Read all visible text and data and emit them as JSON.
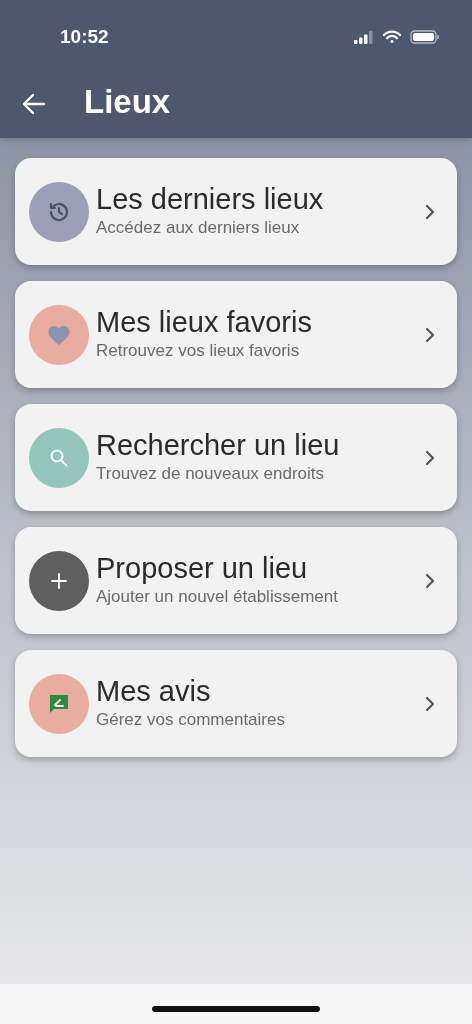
{
  "status_bar": {
    "time": "10:52"
  },
  "header": {
    "title": "Lieux"
  },
  "items": [
    {
      "kind": "history",
      "color": "#9ba0b8",
      "title": "Les derniers lieux",
      "subtitle": "Accédez aux derniers lieux"
    },
    {
      "kind": "heart",
      "color": "#e8aca0",
      "title": "Mes lieux favoris",
      "subtitle": "Retrouvez vos lieux favoris"
    },
    {
      "kind": "search",
      "color": "#93c5bc",
      "title": "Rechercher un lieu",
      "subtitle": "Trouvez de nouveaux endroits"
    },
    {
      "kind": "plus",
      "color": "#5f5f5f",
      "title": "Proposer un lieu",
      "subtitle": "Ajouter un nouvel établissement"
    },
    {
      "kind": "review",
      "color": "#e8aca0",
      "title": "Mes avis",
      "subtitle": "Gérez vos commentaires"
    }
  ]
}
